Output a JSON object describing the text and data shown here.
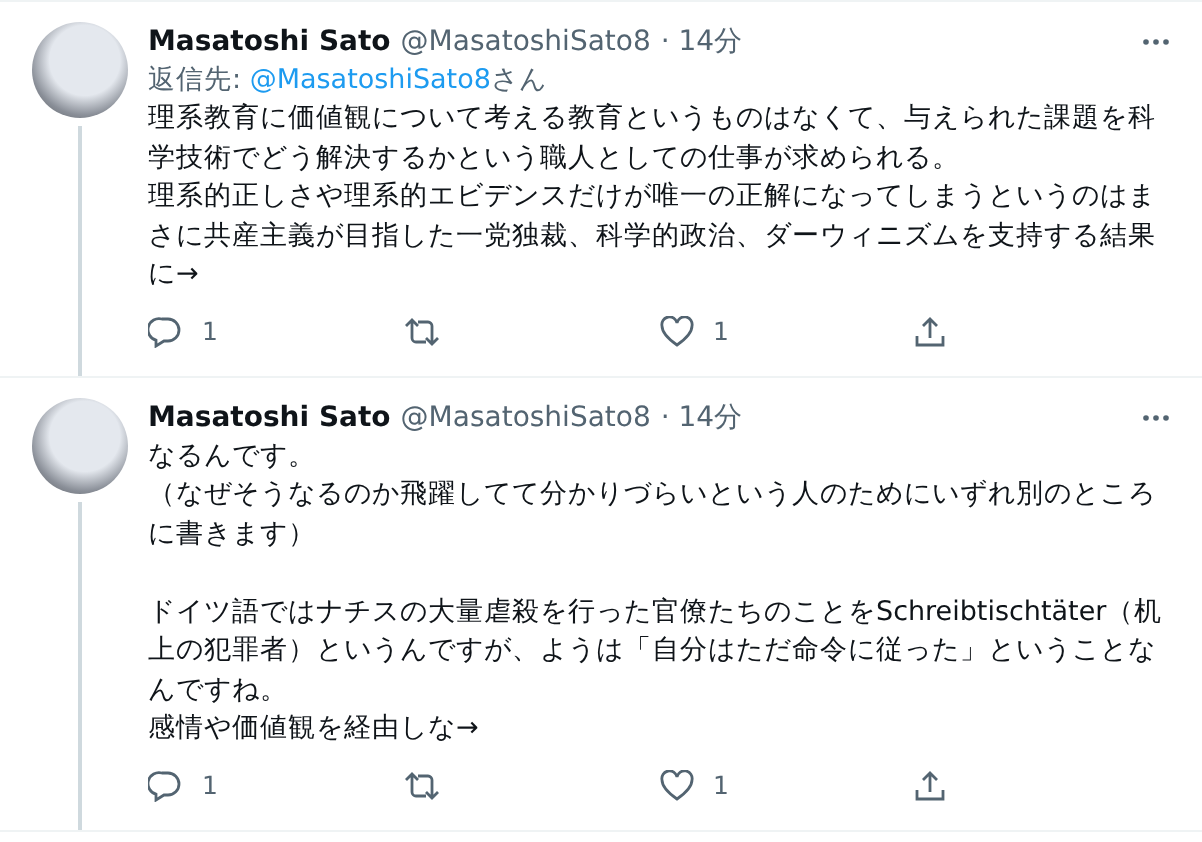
{
  "tweets": [
    {
      "name": "Masatoshi Sato",
      "handle": "@MasatoshiSato8",
      "time": "· 14分",
      "reply_to": {
        "prefix": "返信先: ",
        "handle": "@MasatoshiSato8",
        "suffix": "さん"
      },
      "blocks": [
        [
          "理系教育に価値観について考える教育というものはなくて、与えられた課題を科学技術でどう解決するかという職人としての仕事が求められる。",
          "理系的正しさや理系的エビデンスだけが唯一の正解になってしまうというのはまさに共産主義が目指した一党独裁、科学的政治、ダーウィニズムを支持する結果に→"
        ]
      ],
      "reply_count": "1",
      "like_count": "1"
    },
    {
      "name": "Masatoshi Sato",
      "handle": "@MasatoshiSato8",
      "time": "· 14分",
      "blocks": [
        [
          "なるんです。",
          "（なぜそうなるのか飛躍してて分かりづらいという人のためにいずれ別のところに書きます）"
        ],
        [
          "ドイツ語ではナチスの大量虐殺を行った官僚たちのことをSchreibtischtäter（机上の犯罪者）というんですが、ようは「自分はただ命令に従った」ということなんですね。",
          "感情や価値観を経由しな→"
        ]
      ],
      "reply_count": "1",
      "like_count": "1"
    }
  ]
}
